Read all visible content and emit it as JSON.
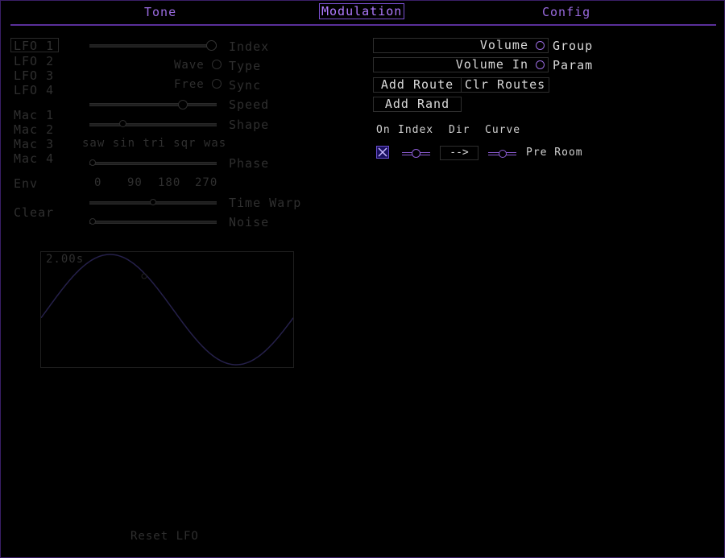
{
  "tabs": [
    {
      "label": "Tone"
    },
    {
      "label": "Modulation"
    },
    {
      "label": "Config"
    }
  ],
  "sidebar": {
    "lfos": [
      "LFO 1",
      "LFO 2",
      "LFO 3",
      "LFO 4"
    ],
    "macros": [
      "Mac 1",
      "Mac 2",
      "Mac 3",
      "Mac 4"
    ],
    "env": "Env",
    "clear": "Clear"
  },
  "lfo": {
    "index_label": "Index",
    "wave_label": "Wave",
    "type_label": "Type",
    "free_label": "Free",
    "sync_label": "Sync",
    "speed_label": "Speed",
    "shape_label": "Shape",
    "wave_names": "saw sin tri sqr was",
    "phase_label": "Phase",
    "phase_ticks": [
      "0",
      "90",
      "180",
      "270"
    ],
    "time_warp_label": "Time Warp",
    "noise_label": "Noise",
    "period": "2.00s",
    "reset": "Reset LFO",
    "sliders": {
      "index": 1.0,
      "speed": 0.75,
      "shape": 0.25,
      "phase": 0.0,
      "time_warp": 0.5,
      "noise": 0.0
    }
  },
  "routing": {
    "target_value": "Volume",
    "target_label": "Group",
    "param_value": "Volume In",
    "param_label": "Param",
    "add_route": "Add Route",
    "clr_routes": "Clr Routes",
    "add_rand": "Add Rand",
    "headers": {
      "on": "On",
      "index": "Index",
      "dir": "Dir",
      "curve": "Curve"
    },
    "route": {
      "on": true,
      "index": 0.5,
      "dir": "-->",
      "curve": 0.5,
      "target": "Pre Room"
    }
  },
  "colors": {
    "accent": "#9a6be0",
    "dim": "#2f2f2f",
    "bright_text": "#d8d8d8",
    "background": "#000000"
  }
}
